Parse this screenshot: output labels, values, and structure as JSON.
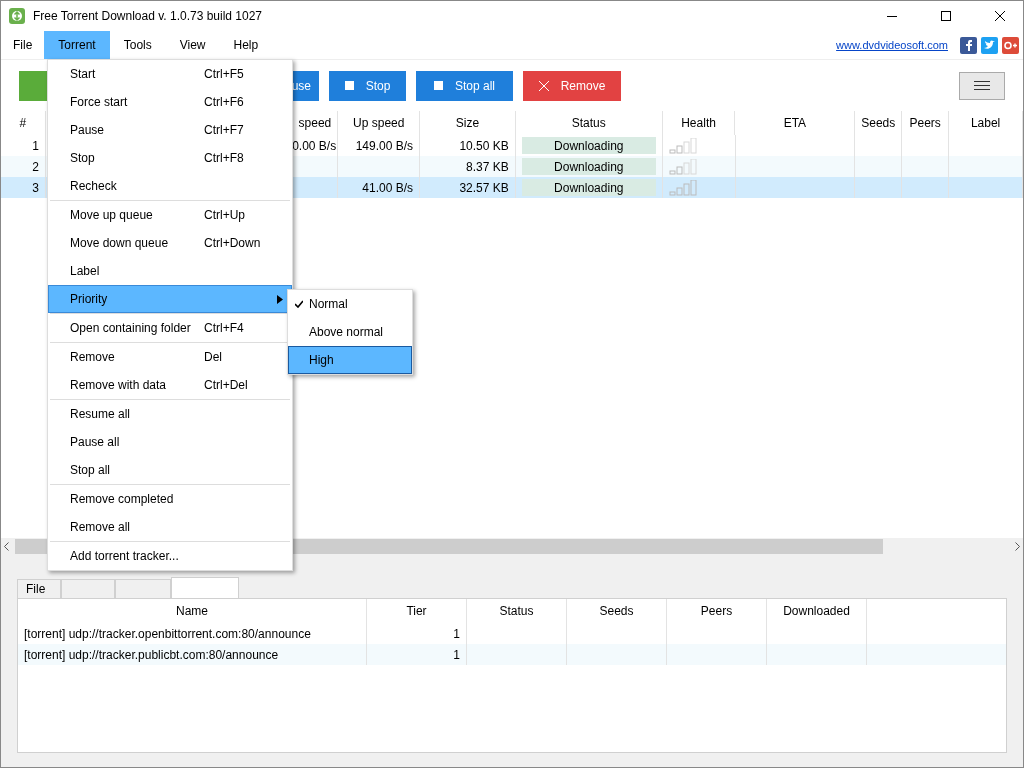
{
  "window": {
    "title": "Free Torrent Download v. 1.0.73 build 1027"
  },
  "menu_bar": [
    {
      "label": "File",
      "selected": false
    },
    {
      "label": "Torrent",
      "selected": true
    },
    {
      "label": "Tools",
      "selected": false
    },
    {
      "label": "View",
      "selected": false
    },
    {
      "label": "Help",
      "selected": false
    }
  ],
  "site_link": "www.dvdvideosoft.com",
  "toolbar": [
    {
      "kind": "add"
    },
    {
      "kind": "plain",
      "label": "use"
    },
    {
      "kind": "stop",
      "label": "Stop"
    },
    {
      "kind": "stop",
      "label": "Stop all"
    },
    {
      "kind": "remove",
      "label": "Remove"
    },
    {
      "kind": "menu"
    }
  ],
  "torrents": {
    "columns": [
      "#",
      "speed",
      "Up speed",
      "Size",
      "Status",
      "Health",
      "ETA",
      "Seeds",
      "Peers",
      "Label"
    ],
    "rows": [
      {
        "num": "1",
        "down_speed": "0.00 B/s",
        "up_speed": "149.00 B/s",
        "size": "10.50 KB",
        "status": "Downloading",
        "selected": false
      },
      {
        "num": "2",
        "size": "8.37 KB",
        "status": "Downloading",
        "selected": false
      },
      {
        "num": "3",
        "up_speed": "41.00 B/s",
        "size": "32.57 KB",
        "status": "Downloading",
        "selected": true
      }
    ]
  },
  "bottom_tabs": [
    {
      "label": "File",
      "selected": false
    }
  ],
  "trackers": {
    "columns": [
      "Name",
      "Tier",
      "Status",
      "Seeds",
      "Peers",
      "Downloaded"
    ],
    "rows": [
      {
        "name": "[torrent] udp://tracker.openbittorrent.com:80/announce",
        "tier": "1"
      },
      {
        "name": "[torrent] udp://tracker.publicbt.com:80/announce",
        "tier": "1"
      }
    ]
  },
  "context_menu": {
    "groups": [
      [
        {
          "label": "Start",
          "shortcut": "Ctrl+F5",
          "selected": false
        },
        {
          "label": "Force start",
          "shortcut": "Ctrl+F6",
          "selected": false
        },
        {
          "label": "Pause",
          "shortcut": "Ctrl+F7",
          "selected": false
        },
        {
          "label": "Stop",
          "shortcut": "Ctrl+F8",
          "selected": false
        },
        {
          "label": "Recheck",
          "selected": false
        }
      ],
      [
        {
          "label": "Move up queue",
          "shortcut": "Ctrl+Up",
          "selected": false
        },
        {
          "label": "Move down queue",
          "shortcut": "Ctrl+Down",
          "selected": false
        },
        {
          "label": "Label",
          "selected": false
        },
        {
          "label": "Priority",
          "selected": true,
          "has_submenu": true
        }
      ],
      [
        {
          "label": "Open containing folder",
          "shortcut": "Ctrl+F4",
          "selected": false
        }
      ],
      [
        {
          "label": "Remove",
          "shortcut": "Del",
          "selected": false
        },
        {
          "label": "Remove with data",
          "shortcut": "Ctrl+Del",
          "selected": false
        }
      ],
      [
        {
          "label": "Resume all",
          "selected": false
        },
        {
          "label": "Pause all",
          "selected": false
        },
        {
          "label": "Stop all",
          "selected": false
        }
      ],
      [
        {
          "label": "Remove completed",
          "selected": false
        },
        {
          "label": "Remove all",
          "selected": false
        }
      ],
      [
        {
          "label": "Add torrent tracker...",
          "selected": false
        }
      ]
    ],
    "submenu": [
      {
        "label": "Normal",
        "checked": true,
        "selected": false
      },
      {
        "label": "Above normal",
        "checked": false,
        "selected": false
      },
      {
        "label": "High",
        "checked": false,
        "selected": true
      }
    ]
  }
}
